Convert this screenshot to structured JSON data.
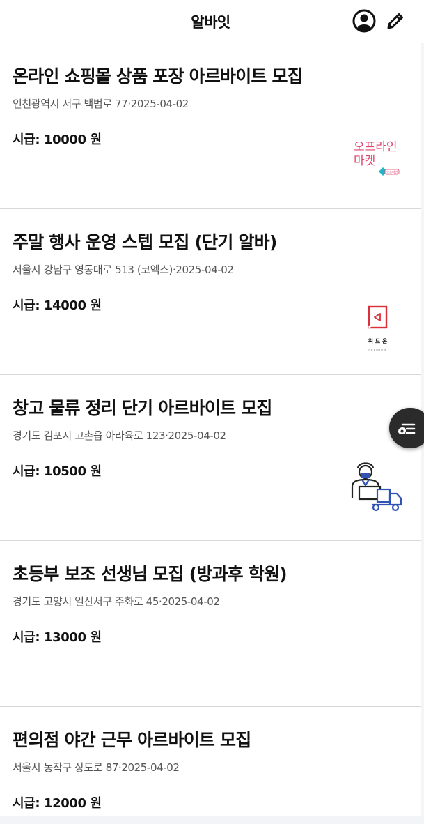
{
  "header": {
    "title": "알바잇",
    "profile_icon": "account-circle-icon",
    "edit_icon": "pencil-icon"
  },
  "jobs": [
    {
      "title": "온라인 쇼핑몰 상품 포장 아르바이트 모집",
      "meta": "인천광역시 서구 백범로 77·2025-04-02",
      "wage": "시급: 10000 원",
      "logo": {
        "line1": "오프라인",
        "line2": "마켓",
        "tag": "오프라인"
      }
    },
    {
      "title": "주말 행사 운영 스텝 모집 (단기 알바)",
      "meta": "서울시 강남구 영동대로 513 (코엑스)·2025-04-02",
      "wage": "시급: 14000 원",
      "logo": {
        "line1": "위 드 온",
        "line2": "PREMIUM"
      }
    },
    {
      "title": "창고 물류 정리 단기 아르바이트 모집",
      "meta": "경기도 김포시 고촌읍 아라육로 123·2025-04-02",
      "wage": "시급: 10500 원",
      "logo": {
        "icon": "delivery-worker-icon"
      }
    },
    {
      "title": "초등부 보조 선생님 모집 (방과후 학원)",
      "meta": "경기도 고양시 일산서구 주화로 45·2025-04-02",
      "wage": "시급: 13000 원"
    },
    {
      "title": "편의점 야간 근무 아르바이트 모집",
      "meta": "서울시 동작구 상도로 87·2025-04-02",
      "wage": "시급: 12000 원"
    }
  ],
  "fab": {
    "icon": "filter-list-icon"
  },
  "colors": {
    "brand_pink": "#e0446f",
    "logo_red": "#d9303a",
    "icon_blue": "#3153b5",
    "divider": "#d8d8d8",
    "fab_bg": "#2b2b2b"
  }
}
